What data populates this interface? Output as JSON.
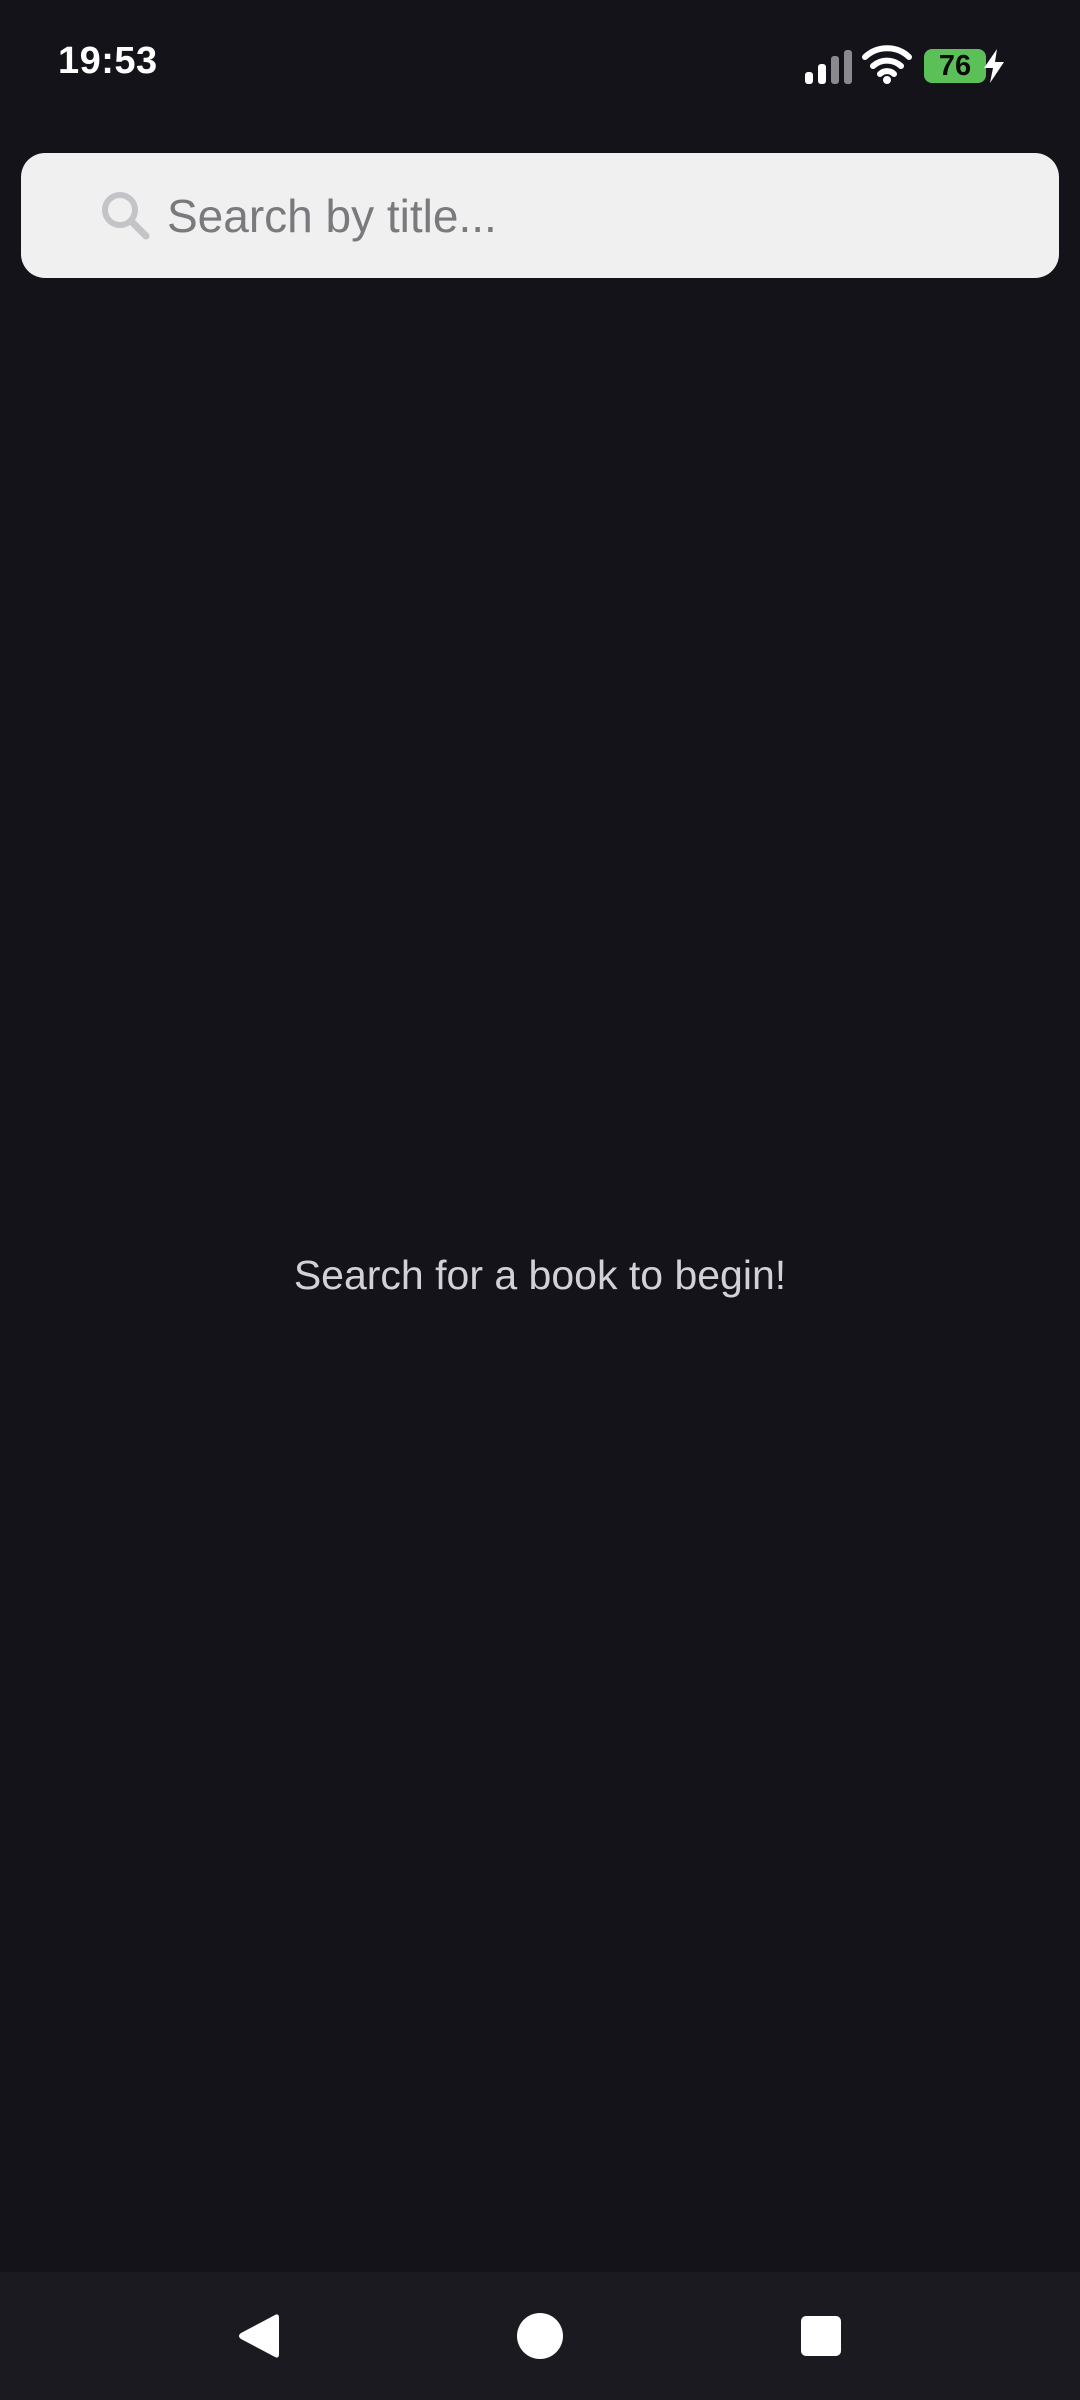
{
  "status_bar": {
    "time": "19:53",
    "battery_level": "76",
    "signal_icon": "cell-signal-icon",
    "wifi_icon": "wifi-icon",
    "charging_icon": "charging-bolt-icon"
  },
  "search": {
    "placeholder": "Search by title...",
    "value": "",
    "icon": "search-icon"
  },
  "empty_state": {
    "message": "Search for a book to begin!"
  },
  "navigation": {
    "back_icon": "back-triangle-icon",
    "home_icon": "home-circle-icon",
    "recents_icon": "recents-square-icon"
  },
  "colors": {
    "background": "#15131a",
    "search_bar": "#f0f0f0",
    "battery": "#5cc058",
    "nav_bar": "#1b1a20"
  }
}
